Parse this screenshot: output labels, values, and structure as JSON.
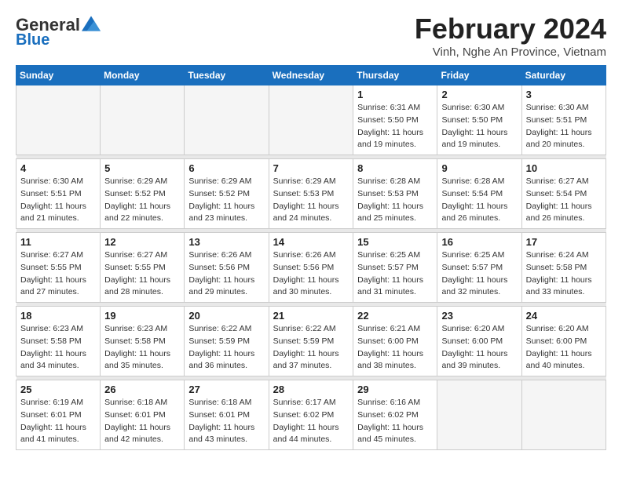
{
  "logo": {
    "general": "General",
    "blue": "Blue"
  },
  "header": {
    "month_year": "February 2024",
    "location": "Vinh, Nghe An Province, Vietnam"
  },
  "days_of_week": [
    "Sunday",
    "Monday",
    "Tuesday",
    "Wednesday",
    "Thursday",
    "Friday",
    "Saturday"
  ],
  "weeks": [
    [
      {
        "day": "",
        "info": ""
      },
      {
        "day": "",
        "info": ""
      },
      {
        "day": "",
        "info": ""
      },
      {
        "day": "",
        "info": ""
      },
      {
        "day": "1",
        "info": "Sunrise: 6:31 AM\nSunset: 5:50 PM\nDaylight: 11 hours and 19 minutes."
      },
      {
        "day": "2",
        "info": "Sunrise: 6:30 AM\nSunset: 5:50 PM\nDaylight: 11 hours and 19 minutes."
      },
      {
        "day": "3",
        "info": "Sunrise: 6:30 AM\nSunset: 5:51 PM\nDaylight: 11 hours and 20 minutes."
      }
    ],
    [
      {
        "day": "4",
        "info": "Sunrise: 6:30 AM\nSunset: 5:51 PM\nDaylight: 11 hours and 21 minutes."
      },
      {
        "day": "5",
        "info": "Sunrise: 6:29 AM\nSunset: 5:52 PM\nDaylight: 11 hours and 22 minutes."
      },
      {
        "day": "6",
        "info": "Sunrise: 6:29 AM\nSunset: 5:52 PM\nDaylight: 11 hours and 23 minutes."
      },
      {
        "day": "7",
        "info": "Sunrise: 6:29 AM\nSunset: 5:53 PM\nDaylight: 11 hours and 24 minutes."
      },
      {
        "day": "8",
        "info": "Sunrise: 6:28 AM\nSunset: 5:53 PM\nDaylight: 11 hours and 25 minutes."
      },
      {
        "day": "9",
        "info": "Sunrise: 6:28 AM\nSunset: 5:54 PM\nDaylight: 11 hours and 26 minutes."
      },
      {
        "day": "10",
        "info": "Sunrise: 6:27 AM\nSunset: 5:54 PM\nDaylight: 11 hours and 26 minutes."
      }
    ],
    [
      {
        "day": "11",
        "info": "Sunrise: 6:27 AM\nSunset: 5:55 PM\nDaylight: 11 hours and 27 minutes."
      },
      {
        "day": "12",
        "info": "Sunrise: 6:27 AM\nSunset: 5:55 PM\nDaylight: 11 hours and 28 minutes."
      },
      {
        "day": "13",
        "info": "Sunrise: 6:26 AM\nSunset: 5:56 PM\nDaylight: 11 hours and 29 minutes."
      },
      {
        "day": "14",
        "info": "Sunrise: 6:26 AM\nSunset: 5:56 PM\nDaylight: 11 hours and 30 minutes."
      },
      {
        "day": "15",
        "info": "Sunrise: 6:25 AM\nSunset: 5:57 PM\nDaylight: 11 hours and 31 minutes."
      },
      {
        "day": "16",
        "info": "Sunrise: 6:25 AM\nSunset: 5:57 PM\nDaylight: 11 hours and 32 minutes."
      },
      {
        "day": "17",
        "info": "Sunrise: 6:24 AM\nSunset: 5:58 PM\nDaylight: 11 hours and 33 minutes."
      }
    ],
    [
      {
        "day": "18",
        "info": "Sunrise: 6:23 AM\nSunset: 5:58 PM\nDaylight: 11 hours and 34 minutes."
      },
      {
        "day": "19",
        "info": "Sunrise: 6:23 AM\nSunset: 5:58 PM\nDaylight: 11 hours and 35 minutes."
      },
      {
        "day": "20",
        "info": "Sunrise: 6:22 AM\nSunset: 5:59 PM\nDaylight: 11 hours and 36 minutes."
      },
      {
        "day": "21",
        "info": "Sunrise: 6:22 AM\nSunset: 5:59 PM\nDaylight: 11 hours and 37 minutes."
      },
      {
        "day": "22",
        "info": "Sunrise: 6:21 AM\nSunset: 6:00 PM\nDaylight: 11 hours and 38 minutes."
      },
      {
        "day": "23",
        "info": "Sunrise: 6:20 AM\nSunset: 6:00 PM\nDaylight: 11 hours and 39 minutes."
      },
      {
        "day": "24",
        "info": "Sunrise: 6:20 AM\nSunset: 6:00 PM\nDaylight: 11 hours and 40 minutes."
      }
    ],
    [
      {
        "day": "25",
        "info": "Sunrise: 6:19 AM\nSunset: 6:01 PM\nDaylight: 11 hours and 41 minutes."
      },
      {
        "day": "26",
        "info": "Sunrise: 6:18 AM\nSunset: 6:01 PM\nDaylight: 11 hours and 42 minutes."
      },
      {
        "day": "27",
        "info": "Sunrise: 6:18 AM\nSunset: 6:01 PM\nDaylight: 11 hours and 43 minutes."
      },
      {
        "day": "28",
        "info": "Sunrise: 6:17 AM\nSunset: 6:02 PM\nDaylight: 11 hours and 44 minutes."
      },
      {
        "day": "29",
        "info": "Sunrise: 6:16 AM\nSunset: 6:02 PM\nDaylight: 11 hours and 45 minutes."
      },
      {
        "day": "",
        "info": ""
      },
      {
        "day": "",
        "info": ""
      }
    ]
  ]
}
